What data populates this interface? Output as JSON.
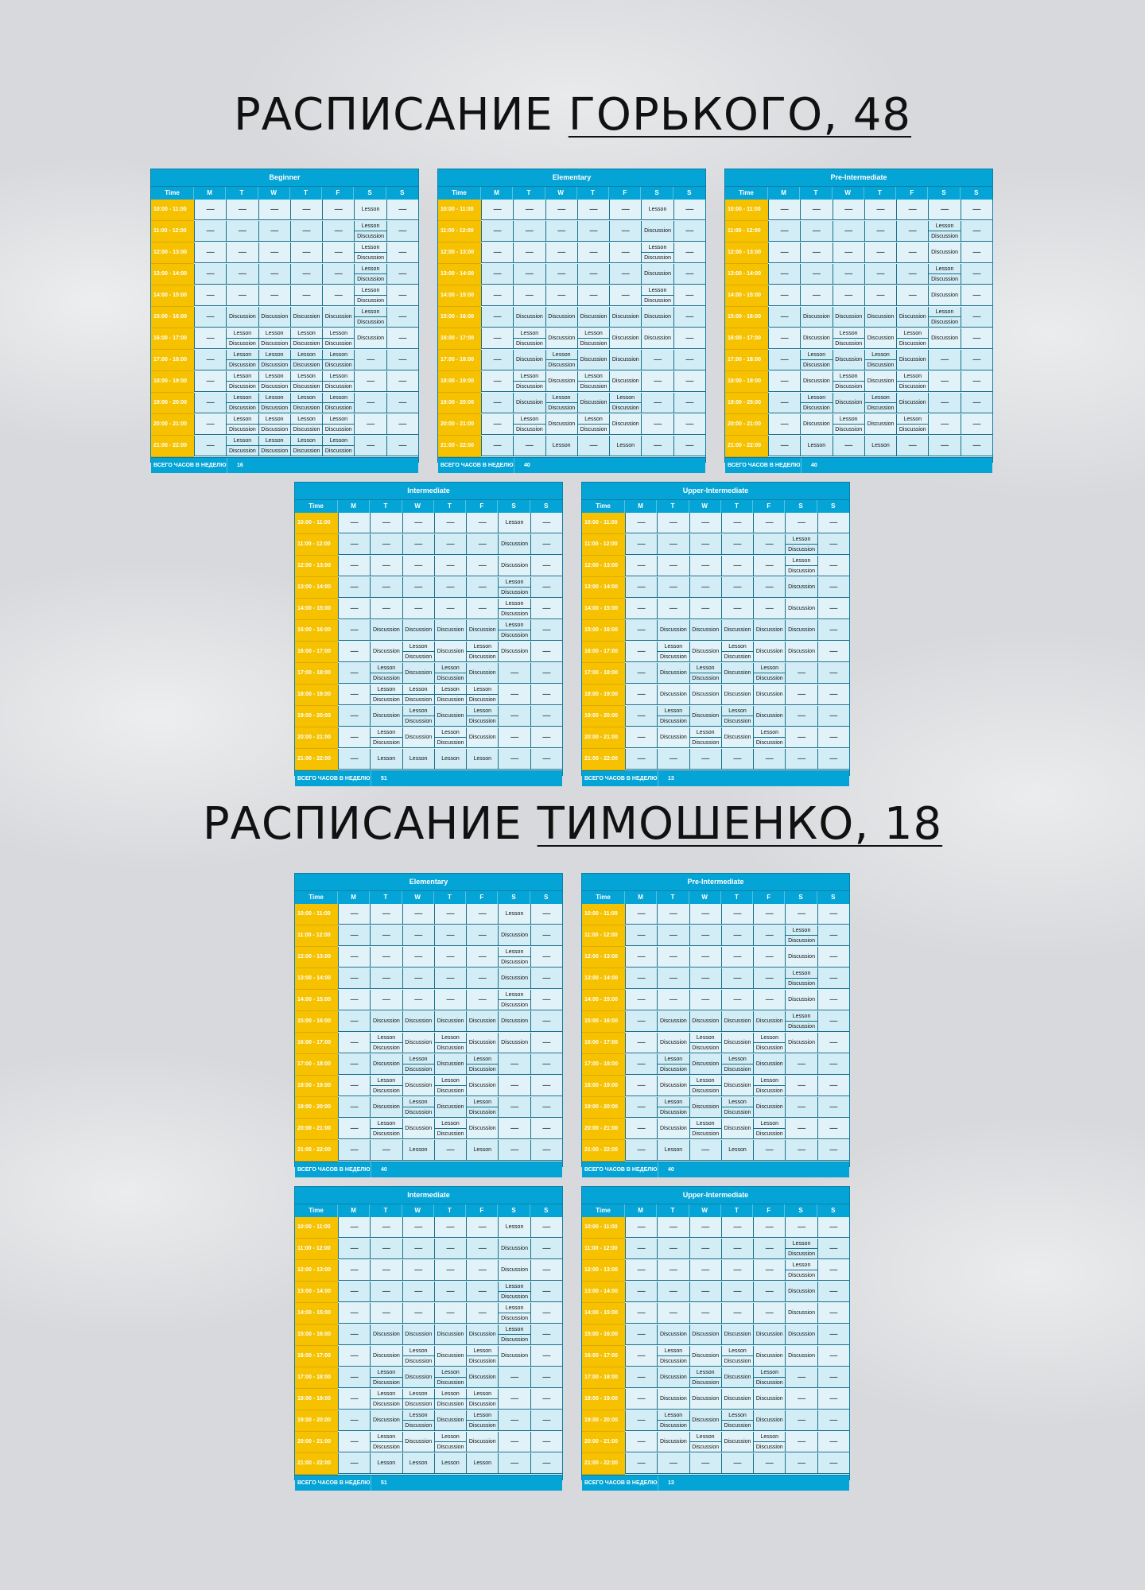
{
  "headings": {
    "gorkogo": {
      "prefix": "РАСПИСАНИЕ ",
      "underlined": "ГОРЬКОГО, 48"
    },
    "timoshenko": {
      "prefix": "РАСПИСАНИЕ ",
      "underlined": "ТИМОШЕНКО, 18"
    }
  },
  "colors": {
    "header": "#05a4d6",
    "time_column": "#f6c200",
    "cell": "#e1f3f9",
    "border": "#1b6f8a"
  },
  "table_labels": {
    "time": "Time",
    "days": [
      "M",
      "T",
      "W",
      "T",
      "F",
      "S",
      "S"
    ],
    "total_label": "ВСЕГО ЧАСОВ В НЕДЕЛЮ",
    "times": [
      "10:00 - 11:00",
      "11:00 - 12:00",
      "12:00 - 13:00",
      "13:00 - 14:00",
      "14:00 - 15:00",
      "15:00 - 16:00",
      "16:00 - 17:00",
      "17:00 - 18:00",
      "18:00 - 19:00",
      "19:00 - 20:00",
      "20:00 - 21:00",
      "21:00 - 22:00"
    ]
  },
  "tables": [
    {
      "title": "Beginner",
      "total": "16",
      "rows": [
        [
          "—",
          "—",
          "—",
          "—",
          "—",
          "Lesson",
          "—"
        ],
        [
          "—",
          "—",
          "—",
          "—",
          "—",
          "Lesson|Discussion",
          "—"
        ],
        [
          "—",
          "—",
          "—",
          "—",
          "—",
          "Lesson|Discussion",
          "—"
        ],
        [
          "—",
          "—",
          "—",
          "—",
          "—",
          "Lesson|Discussion",
          "—"
        ],
        [
          "—",
          "—",
          "—",
          "—",
          "—",
          "Lesson|Discussion",
          "—"
        ],
        [
          "—",
          "Discussion",
          "Discussion",
          "Discussion",
          "Discussion",
          "Lesson|Discussion",
          "—"
        ],
        [
          "—",
          "Lesson|Discussion",
          "Lesson|Discussion",
          "Lesson|Discussion",
          "Lesson|Discussion",
          "Discussion",
          "—"
        ],
        [
          "—",
          "Lesson|Discussion",
          "Lesson|Discussion",
          "Lesson|Discussion",
          "Lesson|Discussion",
          "—",
          "—"
        ],
        [
          "—",
          "Lesson|Discussion",
          "Lesson|Discussion",
          "Lesson|Discussion",
          "Lesson|Discussion",
          "—",
          "—"
        ],
        [
          "—",
          "Lesson|Discussion",
          "Lesson|Discussion",
          "Lesson|Discussion",
          "Lesson|Discussion",
          "—",
          "—"
        ],
        [
          "—",
          "Lesson|Discussion",
          "Lesson|Discussion",
          "Lesson|Discussion",
          "Lesson|Discussion",
          "—",
          "—"
        ],
        [
          "—",
          "Lesson|Discussion",
          "Lesson|Discussion",
          "Lesson|Discussion",
          "Lesson|Discussion",
          "—",
          "—"
        ]
      ]
    },
    {
      "title": "Elementary",
      "total": "40",
      "rows": [
        [
          "—",
          "—",
          "—",
          "—",
          "—",
          "Lesson",
          "—"
        ],
        [
          "—",
          "—",
          "—",
          "—",
          "—",
          "Discussion",
          "—"
        ],
        [
          "—",
          "—",
          "—",
          "—",
          "—",
          "Lesson|Discussion",
          "—"
        ],
        [
          "—",
          "—",
          "—",
          "—",
          "—",
          "Discussion",
          "—"
        ],
        [
          "—",
          "—",
          "—",
          "—",
          "—",
          "Lesson|Discussion",
          "—"
        ],
        [
          "—",
          "Discussion",
          "Discussion",
          "Discussion",
          "Discussion",
          "Discussion",
          "—"
        ],
        [
          "—",
          "Lesson|Discussion",
          "Discussion",
          "Lesson|Discussion",
          "Discussion",
          "Discussion",
          "—"
        ],
        [
          "—",
          "Discussion",
          "Lesson|Discussion",
          "Discussion",
          "Discussion",
          "—",
          "—"
        ],
        [
          "—",
          "Lesson|Discussion",
          "Discussion",
          "Lesson|Discussion",
          "Discussion",
          "—",
          "—"
        ],
        [
          "—",
          "Discussion",
          "Lesson|Discussion",
          "Discussion",
          "Lesson|Discussion",
          "—",
          "—"
        ],
        [
          "—",
          "Lesson|Discussion",
          "Discussion",
          "Lesson|Discussion",
          "Discussion",
          "—",
          "—"
        ],
        [
          "—",
          "—",
          "Lesson",
          "—",
          "Lesson",
          "—",
          "—"
        ]
      ]
    },
    {
      "title": "Pre-Intermediate",
      "total": "40",
      "rows": [
        [
          "—",
          "—",
          "—",
          "—",
          "—",
          "—",
          "—"
        ],
        [
          "—",
          "—",
          "—",
          "—",
          "—",
          "Lesson|Discussion",
          "—"
        ],
        [
          "—",
          "—",
          "—",
          "—",
          "—",
          "Discussion",
          "—"
        ],
        [
          "—",
          "—",
          "—",
          "—",
          "—",
          "Lesson|Discussion",
          "—"
        ],
        [
          "—",
          "—",
          "—",
          "—",
          "—",
          "Discussion",
          "—"
        ],
        [
          "—",
          "Discussion",
          "Discussion",
          "Discussion",
          "Discussion",
          "Lesson|Discussion",
          "—"
        ],
        [
          "—",
          "Discussion",
          "Lesson|Discussion",
          "Discussion",
          "Lesson|Discussion",
          "Discussion",
          "—"
        ],
        [
          "—",
          "Lesson|Discussion",
          "Discussion",
          "Lesson|Discussion",
          "Discussion",
          "—",
          "—"
        ],
        [
          "—",
          "Discussion",
          "Lesson|Discussion",
          "Discussion",
          "Lesson|Discussion",
          "—",
          "—"
        ],
        [
          "—",
          "Lesson|Discussion",
          "Discussion",
          "Lesson|Discussion",
          "Discussion",
          "—",
          "—"
        ],
        [
          "—",
          "Discussion",
          "Lesson|Discussion",
          "Discussion",
          "Lesson|Discussion",
          "—",
          "—"
        ],
        [
          "—",
          "Lesson",
          "—",
          "Lesson",
          "—",
          "—",
          "—"
        ]
      ]
    },
    {
      "title": "Intermediate",
      "total": "51",
      "rows": [
        [
          "—",
          "—",
          "—",
          "—",
          "—",
          "Lesson",
          "—"
        ],
        [
          "—",
          "—",
          "—",
          "—",
          "—",
          "Discussion",
          "—"
        ],
        [
          "—",
          "—",
          "—",
          "—",
          "—",
          "Discussion",
          "—"
        ],
        [
          "—",
          "—",
          "—",
          "—",
          "—",
          "Lesson|Discussion",
          "—"
        ],
        [
          "—",
          "—",
          "—",
          "—",
          "—",
          "Lesson|Discussion",
          "—"
        ],
        [
          "—",
          "Discussion",
          "Discussion",
          "Discussion",
          "Discussion",
          "Lesson|Discussion",
          "—"
        ],
        [
          "—",
          "Discussion",
          "Lesson|Discussion",
          "Discussion",
          "Lesson|Discussion",
          "Discussion",
          "—"
        ],
        [
          "—",
          "Lesson|Discussion",
          "Discussion",
          "Lesson|Discussion",
          "Discussion",
          "—",
          "—"
        ],
        [
          "—",
          "Lesson|Discussion",
          "Lesson|Discussion",
          "Lesson|Discussion",
          "Lesson|Discussion",
          "—",
          "—"
        ],
        [
          "—",
          "Discussion",
          "Lesson|Discussion",
          "Discussion",
          "Lesson|Discussion",
          "—",
          "—"
        ],
        [
          "—",
          "Lesson|Discussion",
          "Discussion",
          "Lesson|Discussion",
          "Discussion",
          "—",
          "—"
        ],
        [
          "—",
          "Lesson",
          "Lesson",
          "Lesson",
          "Lesson",
          "—",
          "—"
        ]
      ]
    },
    {
      "title": "Upper-Intermediate",
      "total": "13",
      "rows": [
        [
          "—",
          "—",
          "—",
          "—",
          "—",
          "—",
          "—"
        ],
        [
          "—",
          "—",
          "—",
          "—",
          "—",
          "Lesson|Discussion",
          "—"
        ],
        [
          "—",
          "—",
          "—",
          "—",
          "—",
          "Lesson|Discussion",
          "—"
        ],
        [
          "—",
          "—",
          "—",
          "—",
          "—",
          "Discussion",
          "—"
        ],
        [
          "—",
          "—",
          "—",
          "—",
          "—",
          "Discussion",
          "—"
        ],
        [
          "—",
          "Discussion",
          "Discussion",
          "Discussion",
          "Discussion",
          "Discussion",
          "—"
        ],
        [
          "—",
          "Lesson|Discussion",
          "Discussion",
          "Lesson|Discussion",
          "Discussion",
          "Discussion",
          "—"
        ],
        [
          "—",
          "Discussion",
          "Lesson|Discussion",
          "Discussion",
          "Lesson|Discussion",
          "—",
          "—"
        ],
        [
          "—",
          "Discussion",
          "Discussion",
          "Discussion",
          "Discussion",
          "—",
          "—"
        ],
        [
          "—",
          "Lesson|Discussion",
          "Discussion",
          "Lesson|Discussion",
          "Discussion",
          "—",
          "—"
        ],
        [
          "—",
          "Discussion",
          "Lesson|Discussion",
          "Discussion",
          "Lesson|Discussion",
          "—",
          "—"
        ],
        [
          "—",
          "—",
          "—",
          "—",
          "—",
          "—",
          "—"
        ]
      ]
    },
    {
      "title": "Elementary",
      "total": "40",
      "rows": [
        [
          "—",
          "—",
          "—",
          "—",
          "—",
          "Lesson",
          "—"
        ],
        [
          "—",
          "—",
          "—",
          "—",
          "—",
          "Discussion",
          "—"
        ],
        [
          "—",
          "—",
          "—",
          "—",
          "—",
          "Lesson|Discussion",
          "—"
        ],
        [
          "—",
          "—",
          "—",
          "—",
          "—",
          "Discussion",
          "—"
        ],
        [
          "—",
          "—",
          "—",
          "—",
          "—",
          "Lesson|Discussion",
          "—"
        ],
        [
          "—",
          "Discussion",
          "Discussion",
          "Discussion",
          "Discussion",
          "Discussion",
          "—"
        ],
        [
          "—",
          "Lesson|Discussion",
          "Discussion",
          "Lesson|Discussion",
          "Discussion",
          "Discussion",
          "—"
        ],
        [
          "—",
          "Discussion",
          "Lesson|Discussion",
          "Discussion",
          "Lesson|Discussion",
          "—",
          "—"
        ],
        [
          "—",
          "Lesson|Discussion",
          "Discussion",
          "Lesson|Discussion",
          "Discussion",
          "—",
          "—"
        ],
        [
          "—",
          "Discussion",
          "Lesson|Discussion",
          "Discussion",
          "Lesson|Discussion",
          "—",
          "—"
        ],
        [
          "—",
          "Lesson|Discussion",
          "Discussion",
          "Lesson|Discussion",
          "Discussion",
          "—",
          "—"
        ],
        [
          "—",
          "—",
          "Lesson",
          "—",
          "Lesson",
          "—",
          "—"
        ]
      ]
    },
    {
      "title": "Pre-Intermediate",
      "total": "40",
      "rows": [
        [
          "—",
          "—",
          "—",
          "—",
          "—",
          "—",
          "—"
        ],
        [
          "—",
          "—",
          "—",
          "—",
          "—",
          "Lesson|Discussion",
          "—"
        ],
        [
          "—",
          "—",
          "—",
          "—",
          "—",
          "Discussion",
          "—"
        ],
        [
          "—",
          "—",
          "—",
          "—",
          "—",
          "Lesson|Discussion",
          "—"
        ],
        [
          "—",
          "—",
          "—",
          "—",
          "—",
          "Discussion",
          "—"
        ],
        [
          "—",
          "Discussion",
          "Discussion",
          "Discussion",
          "Discussion",
          "Lesson|Discussion",
          "—"
        ],
        [
          "—",
          "Discussion",
          "Lesson|Discussion",
          "Discussion",
          "Lesson|Discussion",
          "Discussion",
          "—"
        ],
        [
          "—",
          "Lesson|Discussion",
          "Discussion",
          "Lesson|Discussion",
          "Discussion",
          "—",
          "—"
        ],
        [
          "—",
          "Discussion",
          "Lesson|Discussion",
          "Discussion",
          "Lesson|Discussion",
          "—",
          "—"
        ],
        [
          "—",
          "Lesson|Discussion",
          "Discussion",
          "Lesson|Discussion",
          "Discussion",
          "—",
          "—"
        ],
        [
          "—",
          "Discussion",
          "Lesson|Discussion",
          "Discussion",
          "Lesson|Discussion",
          "—",
          "—"
        ],
        [
          "—",
          "Lesson",
          "—",
          "Lesson",
          "—",
          "—",
          "—"
        ]
      ]
    },
    {
      "title": "Intermediate",
      "total": "51",
      "rows": [
        [
          "—",
          "—",
          "—",
          "—",
          "—",
          "Lesson",
          "—"
        ],
        [
          "—",
          "—",
          "—",
          "—",
          "—",
          "Discussion",
          "—"
        ],
        [
          "—",
          "—",
          "—",
          "—",
          "—",
          "Discussion",
          "—"
        ],
        [
          "—",
          "—",
          "—",
          "—",
          "—",
          "Lesson|Discussion",
          "—"
        ],
        [
          "—",
          "—",
          "—",
          "—",
          "—",
          "Lesson|Discussion",
          "—"
        ],
        [
          "—",
          "Discussion",
          "Discussion",
          "Discussion",
          "Discussion",
          "Lesson|Discussion",
          "—"
        ],
        [
          "—",
          "Discussion",
          "Lesson|Discussion",
          "Discussion",
          "Lesson|Discussion",
          "Discussion",
          "—"
        ],
        [
          "—",
          "Lesson|Discussion",
          "Discussion",
          "Lesson|Discussion",
          "Discussion",
          "—",
          "—"
        ],
        [
          "—",
          "Lesson|Discussion",
          "Lesson|Discussion",
          "Lesson|Discussion",
          "Lesson|Discussion",
          "—",
          "—"
        ],
        [
          "—",
          "Discussion",
          "Lesson|Discussion",
          "Discussion",
          "Lesson|Discussion",
          "—",
          "—"
        ],
        [
          "—",
          "Lesson|Discussion",
          "Discussion",
          "Lesson|Discussion",
          "Discussion",
          "—",
          "—"
        ],
        [
          "—",
          "Lesson",
          "Lesson",
          "Lesson",
          "Lesson",
          "—",
          "—"
        ]
      ]
    },
    {
      "title": "Upper-Intermediate",
      "total": "13",
      "rows": [
        [
          "—",
          "—",
          "—",
          "—",
          "—",
          "—",
          "—"
        ],
        [
          "—",
          "—",
          "—",
          "—",
          "—",
          "Lesson|Discussion",
          "—"
        ],
        [
          "—",
          "—",
          "—",
          "—",
          "—",
          "Lesson|Discussion",
          "—"
        ],
        [
          "—",
          "—",
          "—",
          "—",
          "—",
          "Discussion",
          "—"
        ],
        [
          "—",
          "—",
          "—",
          "—",
          "—",
          "Discussion",
          "—"
        ],
        [
          "—",
          "Discussion",
          "Discussion",
          "Discussion",
          "Discussion",
          "Discussion",
          "—"
        ],
        [
          "—",
          "Lesson|Discussion",
          "Discussion",
          "Lesson|Discussion",
          "Discussion",
          "Discussion",
          "—"
        ],
        [
          "—",
          "Discussion",
          "Lesson|Discussion",
          "Discussion",
          "Lesson|Discussion",
          "—",
          "—"
        ],
        [
          "—",
          "Discussion",
          "Discussion",
          "Discussion",
          "Discussion",
          "—",
          "—"
        ],
        [
          "—",
          "Lesson|Discussion",
          "Discussion",
          "Lesson|Discussion",
          "Discussion",
          "—",
          "—"
        ],
        [
          "—",
          "Discussion",
          "Lesson|Discussion",
          "Discussion",
          "Lesson|Discussion",
          "—",
          "—"
        ],
        [
          "—",
          "—",
          "—",
          "—",
          "—",
          "—",
          "—"
        ]
      ]
    }
  ]
}
